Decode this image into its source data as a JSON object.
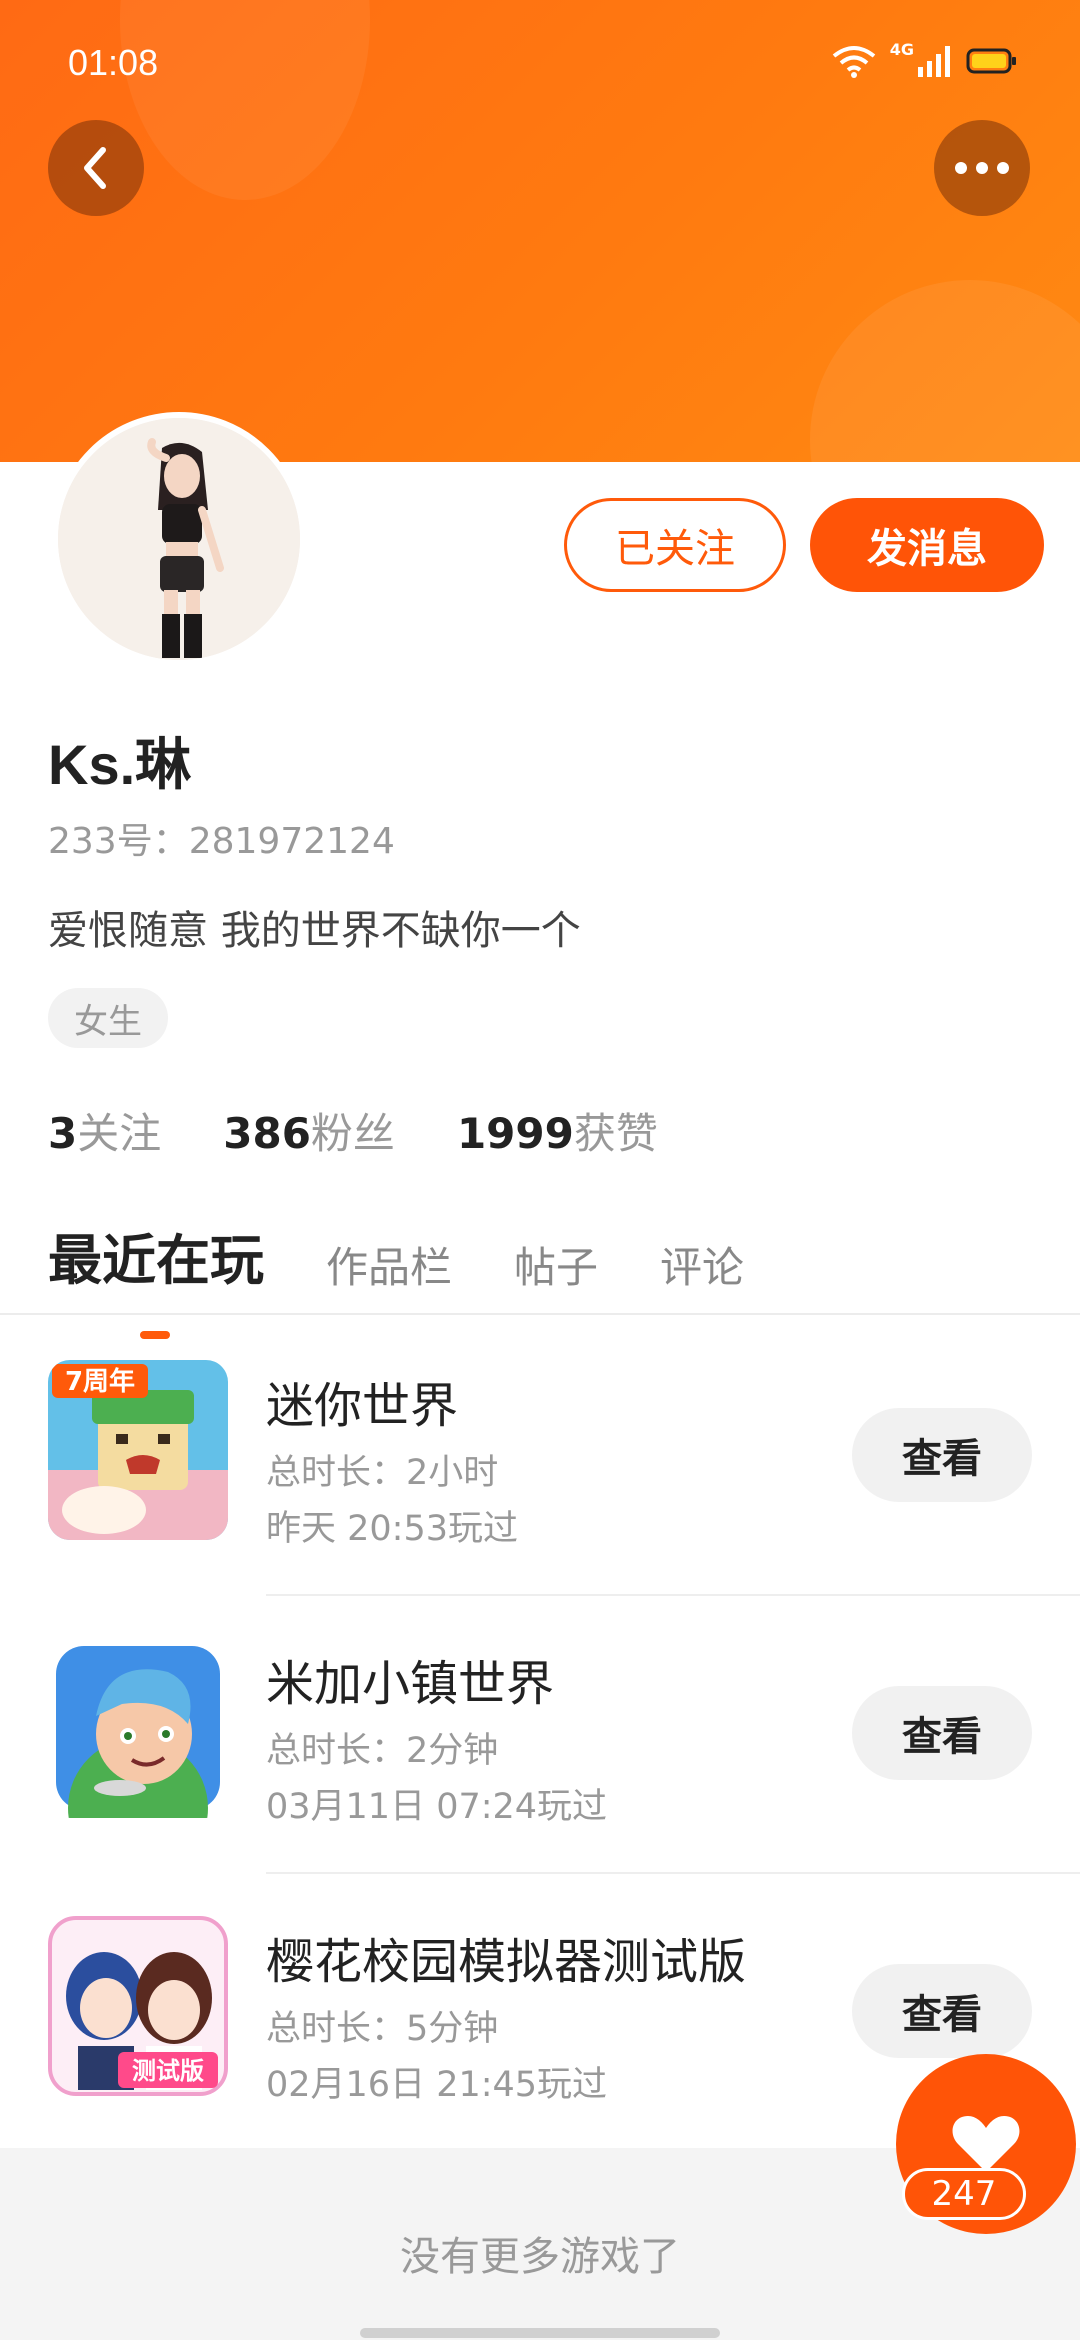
{
  "status_bar": {
    "time": "01:08",
    "network": "4G"
  },
  "profile": {
    "name": "Ks.琳",
    "id_text": "233号：281972124",
    "bio": "爱恨随意 我的世界不缺你一个",
    "gender_tag": "女生",
    "follow_button": "已关注",
    "message_button": "发消息"
  },
  "stats": [
    {
      "value": "3",
      "label": "关注"
    },
    {
      "value": "386",
      "label": "粉丝"
    },
    {
      "value": "1999",
      "label": "获赞"
    }
  ],
  "tabs": [
    "最近在玩",
    "作品栏",
    "帖子",
    "评论"
  ],
  "games": [
    {
      "title": "迷你世界",
      "duration": "总时长：2小时",
      "last_played": "昨天 20:53玩过",
      "button": "查看"
    },
    {
      "title": "米加小镇世界",
      "duration": "总时长：2分钟",
      "last_played": "03月11日 07:24玩过",
      "button": "查看"
    },
    {
      "title": "樱花校园模拟器测试版",
      "duration": "总时长：5分钟",
      "last_played": "02月16日 21:45玩过",
      "button": "查看"
    }
  ],
  "game_icon_texts": [
    "7周年",
    "测试版"
  ],
  "footer_text": "没有更多游戏了",
  "like_count": "247",
  "colors": {
    "accent": "#ff5407",
    "header": "#ff7010"
  },
  "icons": [
    "back-arrow-icon",
    "more-dots-icon",
    "wifi-icon",
    "signal-icon",
    "battery-icon",
    "heart-icon"
  ]
}
